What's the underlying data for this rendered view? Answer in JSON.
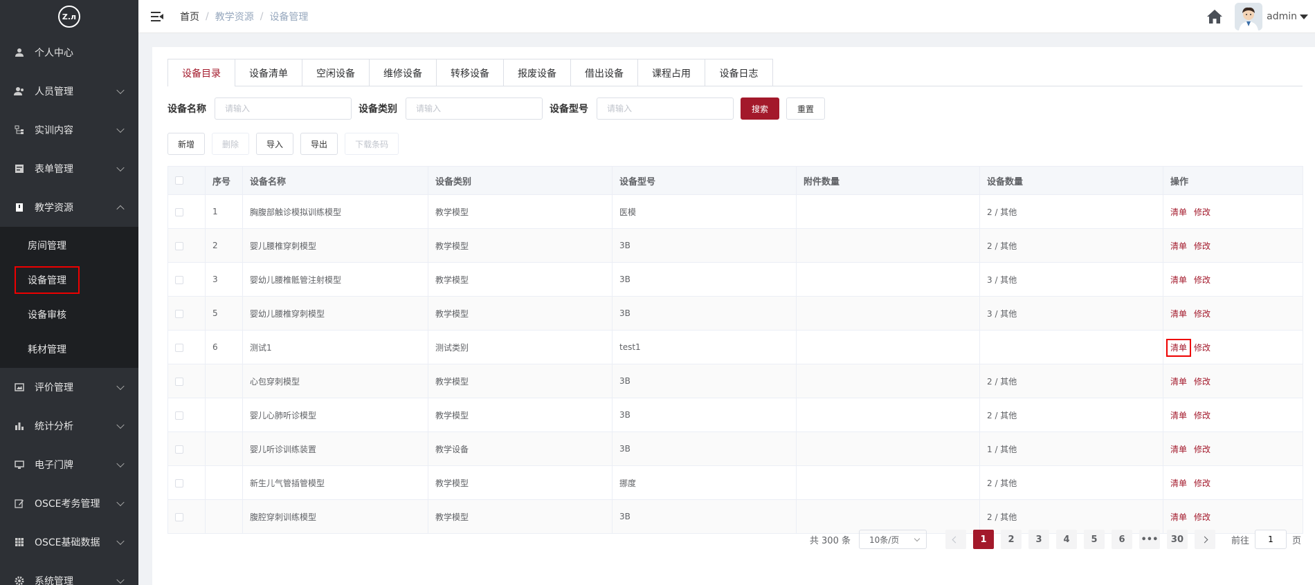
{
  "sidebar": {
    "logo_text": "Z.л",
    "items": [
      {
        "label": "个人中心",
        "icon": "user-icon",
        "has_arrow": false
      },
      {
        "label": "人员管理",
        "icon": "users-icon",
        "has_arrow": true
      },
      {
        "label": "实训内容",
        "icon": "tree-icon",
        "has_arrow": true
      },
      {
        "label": "表单管理",
        "icon": "form-icon",
        "has_arrow": true
      },
      {
        "label": "教学资源",
        "icon": "book-icon",
        "has_arrow": true,
        "expanded": true
      },
      {
        "label": "评价管理",
        "icon": "image-icon",
        "has_arrow": true
      },
      {
        "label": "统计分析",
        "icon": "bar-chart-icon",
        "has_arrow": true
      },
      {
        "label": "电子门牌",
        "icon": "monitor-icon",
        "has_arrow": true
      },
      {
        "label": "OSCE考务管理",
        "icon": "edit-icon",
        "has_arrow": true
      },
      {
        "label": "OSCE基础数据",
        "icon": "table-icon",
        "has_arrow": true
      },
      {
        "label": "系统管理",
        "icon": "gear-icon",
        "has_arrow": true
      }
    ],
    "submenu": [
      {
        "label": "房间管理"
      },
      {
        "label": "设备管理",
        "active": true
      },
      {
        "label": "设备审核"
      },
      {
        "label": "耗材管理"
      }
    ]
  },
  "topbar": {
    "breadcrumb": [
      "首页",
      "教学资源",
      "设备管理"
    ],
    "username": "admin"
  },
  "tabs": [
    "设备目录",
    "设备清单",
    "空闲设备",
    "维修设备",
    "转移设备",
    "报废设备",
    "借出设备",
    "课程占用",
    "设备日志"
  ],
  "filters": {
    "name_label": "设备名称",
    "category_label": "设备类别",
    "model_label": "设备型号",
    "placeholder": "请输入",
    "search": "搜索",
    "reset": "重置"
  },
  "actions": {
    "add": "新增",
    "delete": "删除",
    "import": "导入",
    "export": "导出",
    "download_barcode": "下载条码"
  },
  "table": {
    "headers": [
      "序号",
      "设备名称",
      "设备类别",
      "设备型号",
      "附件数量",
      "设备数量",
      "操作"
    ],
    "op_list": "清单",
    "op_edit": "修改",
    "rows": [
      {
        "no": "1",
        "name": "胸腹部触诊模拟训练模型",
        "category": "教学模型",
        "model": "医模",
        "attach": "",
        "qty": "2 / 其他"
      },
      {
        "no": "2",
        "name": "婴儿腰椎穿刺模型",
        "category": "教学模型",
        "model": "3B",
        "attach": "",
        "qty": "2 / 其他"
      },
      {
        "no": "3",
        "name": "婴幼儿腰椎骶管注射模型",
        "category": "教学模型",
        "model": "3B",
        "attach": "",
        "qty": "3 / 其他"
      },
      {
        "no": "5",
        "name": "婴幼儿腰椎穿刺模型",
        "category": "教学模型",
        "model": "3B",
        "attach": "",
        "qty": "3 / 其他"
      },
      {
        "no": "6",
        "name": "测试1",
        "category": "测试类别",
        "model": "test1",
        "attach": "",
        "qty": "",
        "highlight": true
      },
      {
        "no": "",
        "name": "心包穿刺模型",
        "category": "教学模型",
        "model": "3B",
        "attach": "",
        "qty": "2 / 其他"
      },
      {
        "no": "",
        "name": "婴儿心肺听诊模型",
        "category": "教学模型",
        "model": "3B",
        "attach": "",
        "qty": "2 / 其他"
      },
      {
        "no": "",
        "name": "婴儿听诊训练装置",
        "category": "教学设备",
        "model": "3B",
        "attach": "",
        "qty": "1 / 其他"
      },
      {
        "no": "",
        "name": "新生儿气管插管模型",
        "category": "教学模型",
        "model": "挪度",
        "attach": "",
        "qty": "2 / 其他"
      },
      {
        "no": "",
        "name": "腹腔穿刺训练模型",
        "category": "教学模型",
        "model": "3B",
        "attach": "",
        "qty": "2 / 其他"
      }
    ]
  },
  "pagination": {
    "total": "共 300 条",
    "page_size": "10条/页",
    "pages": [
      "1",
      "2",
      "3",
      "4",
      "5",
      "6",
      "•••",
      "30"
    ],
    "current": "1",
    "goto_label": "前往",
    "goto_value": "1",
    "page_suffix": "页"
  },
  "colors": {
    "accent": "#a3192b",
    "sidebar_bg": "#2d3035",
    "highlight_box": "#e00000"
  }
}
